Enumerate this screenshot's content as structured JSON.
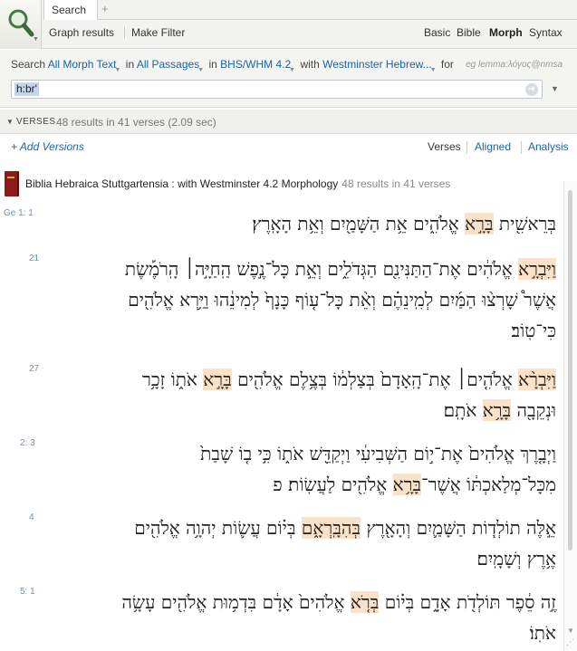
{
  "app": {
    "tab_title": "Search",
    "add_tab": "+"
  },
  "toolbar": {
    "graph_results": "Graph results",
    "make_filter": "Make Filter",
    "types": [
      "Basic",
      "Bible",
      "Morph",
      "Syntax"
    ],
    "active_type": "Morph"
  },
  "query": {
    "prefix": "Search",
    "morph_text": "All Morph Text",
    "in_1": "in",
    "passages": "All Passages",
    "in_2": "in",
    "version": "BHS/WHM 4.2",
    "with": "with",
    "morphology": "Westminster Hebrew...",
    "for": "for",
    "example": "eg lemma:λόγος@nmsa",
    "value": "h:br'"
  },
  "results": {
    "label": "VERSES",
    "summary": "48 results in 41 verses (2.09 sec)"
  },
  "view": {
    "add_versions": "+ Add Versions",
    "modes": [
      "Verses",
      "Aligned",
      "Analysis"
    ],
    "active_mode": "Verses"
  },
  "resource": {
    "title": "Biblia Hebraica Stuttgartensia : with Westminster 4.2 Morphology",
    "count": "48 results in 41 verses"
  },
  "verses": [
    {
      "ref": "Ge 1: 1",
      "lines": [
        [
          {
            "t": "בְּרֵאשִׁ֖ית ",
            "h": false
          },
          {
            "t": "בָּרָ֣א",
            "h": true
          },
          {
            "t": " אֱלֹהִ֑ים אֵ֥ת הַשָּׁמַ֖יִם וְאֵ֥ת הָאָֽרֶץ׃",
            "h": false
          }
        ]
      ]
    },
    {
      "ref": "21",
      "lines": [
        [
          {
            "t": "וַיִּבְרָ֣א",
            "h": true
          },
          {
            "t": " אֱלֹהִ֔ים אֶת־הַתַּנִּינִ֖ם הַגְּדֹלִ֑ים וְאֵ֣ת כָּל־נֶ֣פֶשׁ הַֽחַיָּ֣ה׀ הָֽרֹמֶ֡שֶׂת",
            "h": false
          }
        ],
        [
          {
            "t": "אֲשֶׁר֩ שָׁרְצ֨וּ הַמַּ֜יִם לְמִֽינֵהֶ֗ם וְאֵ֨ת כָּל־ע֤וֹף כָּנָף֙ לְמִינֵ֔הוּ וַיַּ֥רְא אֱלֹהִ֖ים",
            "h": false
          }
        ],
        [
          {
            "t": "כִּי־טֽוֹב׃",
            "h": false
          }
        ]
      ]
    },
    {
      "ref": "27",
      "lines": [
        [
          {
            "t": "וַיִּבְרָ֨א",
            "h": true
          },
          {
            "t": " אֱלֹהִ֤ים׀ אֶת־הָֽאָדָם֙ בְּצַלְמ֔וֹ בְּצֶ֥לֶם אֱלֹהִ֖ים ",
            "h": false
          },
          {
            "t": "בָּרָ֣א",
            "h": true
          },
          {
            "t": " אֹת֑וֹ זָכָ֥ר",
            "h": false
          }
        ],
        [
          {
            "t": "וּנְקֵבָ֖ה ",
            "h": false
          },
          {
            "t": "בָּרָ֥א",
            "h": true
          },
          {
            "t": " אֹתָֽם׃",
            "h": false
          }
        ]
      ]
    },
    {
      "ref": "2: 3",
      "lines": [
        [
          {
            "t": "וַיְבָ֤רֶךְ אֱלֹהִים֙ אֶת־י֣וֹם הַשְּׁבִיעִ֔י וַיְקַדֵּ֖שׁ אֹת֑וֹ כִּ֣י ב֤וֹ שָׁבַת֙",
            "h": false
          }
        ],
        [
          {
            "t": "מִכָּל־מְלַאכְתּ֔וֹ אֲשֶׁר־",
            "h": false
          },
          {
            "t": "בָּרָ֥א",
            "h": true
          },
          {
            "t": " אֱלֹהִ֖ים לַעֲשֽׂוֹת׃ פ",
            "h": false
          }
        ]
      ]
    },
    {
      "ref": "4",
      "lines": [
        [
          {
            "t": "אֵ֣לֶּה תוֹלְד֧וֹת הַשָּׁמַ֛יִם וְהָאָ֖רֶץ ",
            "h": false
          },
          {
            "t": "בְּהִבָּֽרְאָ֑ם",
            "h": true
          },
          {
            "t": " בְּי֗וֹם עֲשׂ֛וֹת יְהוָ֥ה אֱלֹהִ֖ים",
            "h": false
          }
        ],
        [
          {
            "t": "אֶ֥רֶץ וְשָׁמָֽיִם׃",
            "h": false
          }
        ]
      ]
    },
    {
      "ref": "5: 1",
      "lines": [
        [
          {
            "t": "זֶ֣ה סֵ֔פֶר תּוֹלְדֹ֖ת אָדָ֑ם בְּי֗וֹם ",
            "h": false
          },
          {
            "t": "בְּרֹ֤א",
            "h": true
          },
          {
            "t": " אֱלֹהִים֙ אָדָ֔ם בִּדְמ֥וּת אֱלֹהִ֖ים עָשָׂ֥ה",
            "h": false
          }
        ],
        [
          {
            "t": "אֹתֽוֹ׃",
            "h": false
          }
        ]
      ]
    }
  ]
}
